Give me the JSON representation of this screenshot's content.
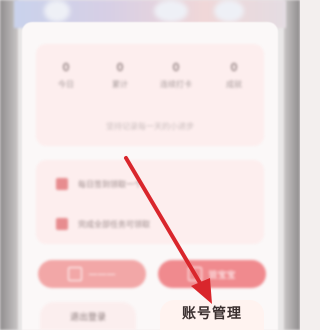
{
  "stats": [
    {
      "value": "0",
      "label": "今日"
    },
    {
      "value": "0",
      "label": "累计"
    },
    {
      "value": "0",
      "label": "连续打卡"
    },
    {
      "value": "0",
      "label": "成就"
    }
  ],
  "stats_hint": "坚持记录每一天的小进步",
  "tasks": [
    {
      "label": "每日签到领取一个"
    },
    {
      "label": "完成全部任务可领取"
    }
  ],
  "buttons": {
    "left_label": "一一一",
    "right_label": "管宝宝"
  },
  "bottom": {
    "left_label": "退出登录",
    "account_label": "账号管理"
  },
  "colors": {
    "accent": "#f08a8e",
    "arrow": "#d9262c"
  },
  "icons": {
    "task_checkbox": "checkbox-icon",
    "button_icon": "box-icon"
  }
}
